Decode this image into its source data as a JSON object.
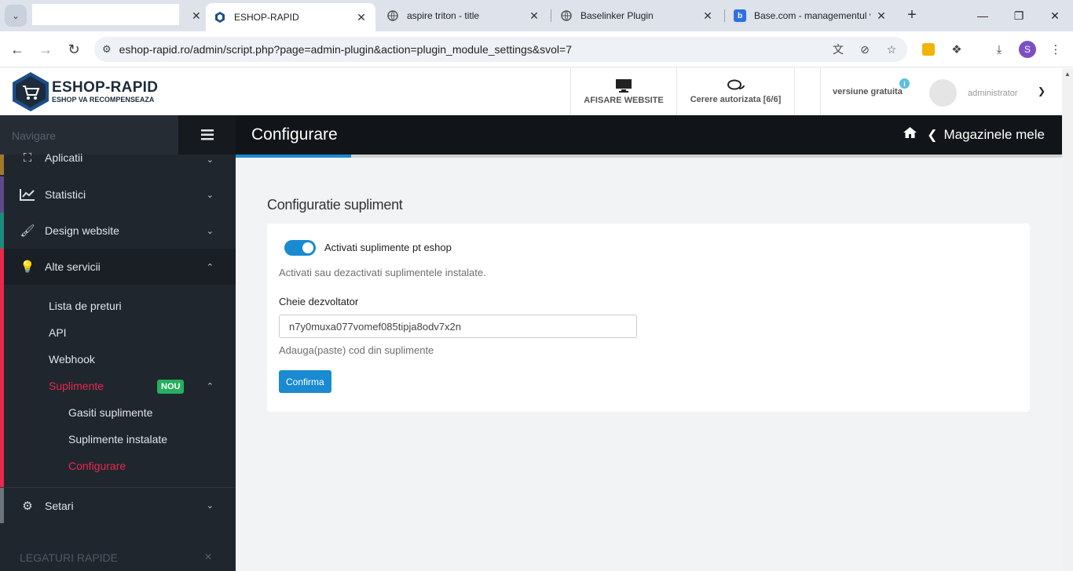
{
  "browser": {
    "tabs": [
      {
        "title": "",
        "favicon": "blank"
      },
      {
        "title": "ESHOP-RAPID",
        "favicon": "hex-logo-icon",
        "active": true
      },
      {
        "title": "aspire triton - title",
        "favicon": "globe-icon"
      },
      {
        "title": "Baselinker Plugin",
        "favicon": "globe-icon"
      },
      {
        "title": "Base.com - managementul v",
        "favicon": "base-b-icon"
      }
    ],
    "url": "eshop-rapid.ro/admin/script.php?page=admin-plugin&action=plugin_module_settings&svol=7",
    "profile_initial": "S",
    "profile_color": "#7b4fc4"
  },
  "header": {
    "logo_title": "ESHOP-RAPID",
    "logo_subtitle": "ESHOP VA RECOMPENSEAZA",
    "website_label": "AFISARE WEBSITE",
    "auth_label": "Cerere autorizata [6/6]",
    "version_label": "versiune gratuita",
    "user_name": "administrator"
  },
  "sidebar": {
    "nav_label": "Navigare",
    "items": [
      {
        "label": "Aplicatii",
        "icon": "gamepad-icon",
        "edge": "#a07a2c"
      },
      {
        "label": "Statistici",
        "icon": "chart-line-icon",
        "edge": "#5e4a8a"
      },
      {
        "label": "Design website",
        "icon": "brush-icon",
        "edge": "#1f8a7a"
      },
      {
        "label": "Alte servicii",
        "icon": "lightbulb-icon",
        "edge": "#e8294c"
      }
    ],
    "sub_items": [
      {
        "label": "Lista de preturi"
      },
      {
        "label": "API"
      },
      {
        "label": "Webhook"
      },
      {
        "label": "Suplimente",
        "badge": "NOU"
      }
    ],
    "sub_sub_items": [
      {
        "label": "Gasiti suplimente"
      },
      {
        "label": "Suplimente instalate"
      },
      {
        "label": "Configurare"
      }
    ],
    "setari": {
      "label": "Setari",
      "icon": "cogs-icon"
    },
    "quick_links": "LEGATURI RAPIDE",
    "accent_color": "#e8294c"
  },
  "page": {
    "title": "Configurare",
    "breadcrumb": "Magazinele mele",
    "section_title": "Configuratie supliment",
    "toggle_label": "Activati suplimente pt eshop",
    "toggle_on": true,
    "toggle_help": "Activati sau dezactivati suplimentele instalate.",
    "key_label": "Cheie dezvoltator",
    "key_value": "n7y0muxa077vomef085tipja8odv7x2n",
    "key_help": "Adauga(paste) cod din suplimente",
    "confirm_label": "Confirma",
    "accent_color": "#1a8ad1"
  }
}
